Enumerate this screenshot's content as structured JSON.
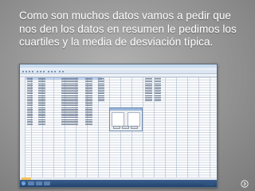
{
  "slide": {
    "caption": "Como son muchos datos vamos a pedir que nos den los datos en resumen le pedimos los cuartiles y la media de desviación típica."
  },
  "screenshot": {
    "app": "spss-data-editor",
    "dialog_open": true
  },
  "navigation": {
    "icon": "next-slide-arrow-icon"
  }
}
